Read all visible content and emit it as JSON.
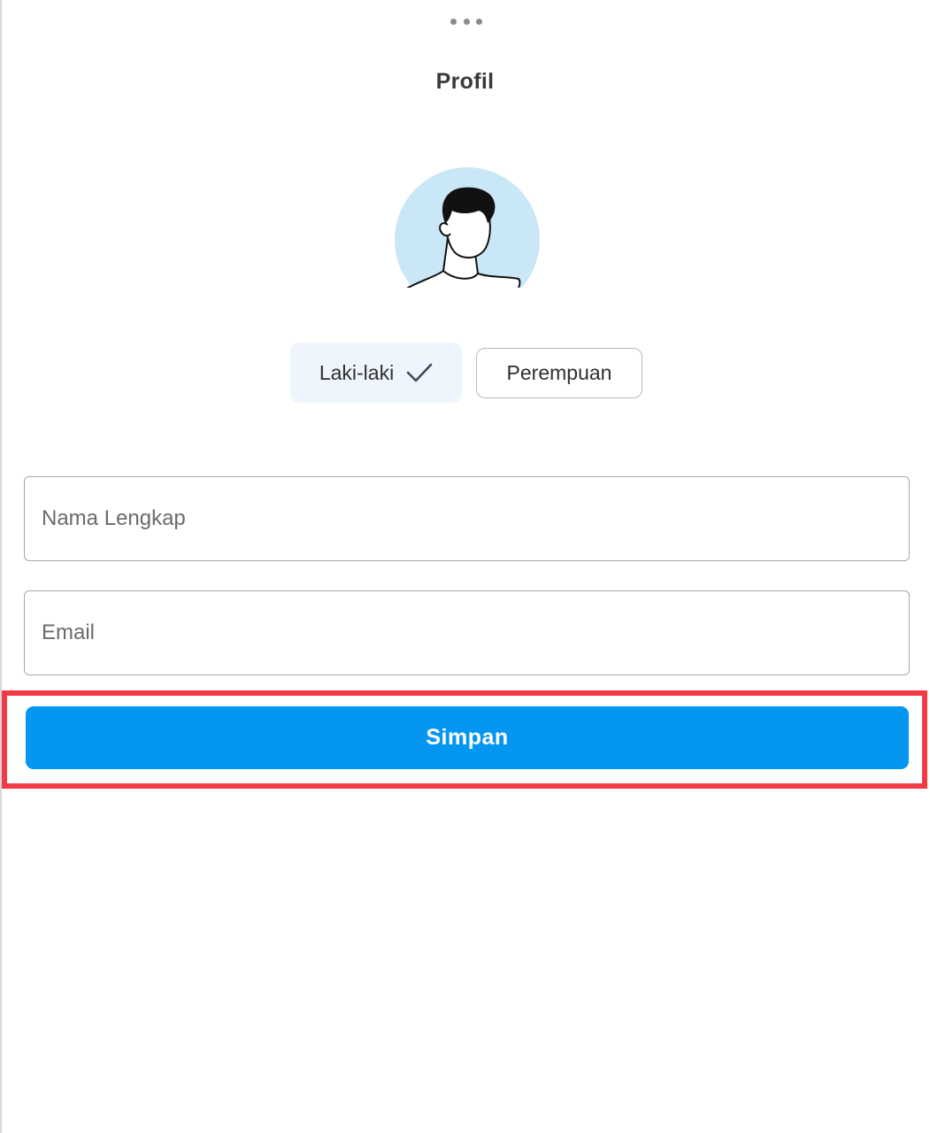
{
  "header": {
    "menu_icon": "more-horizontal-icon",
    "title": "Profil"
  },
  "avatar": {
    "icon": "male-avatar-icon",
    "background_color": "#c9e7f6"
  },
  "gender": {
    "options": [
      {
        "label": "Laki-laki",
        "selected": true,
        "icon": "check-icon"
      },
      {
        "label": "Perempuan",
        "selected": false
      }
    ]
  },
  "form": {
    "full_name": {
      "placeholder": "Nama Lengkap",
      "value": ""
    },
    "email": {
      "placeholder": "Email",
      "value": ""
    },
    "save_label": "Simpan"
  },
  "colors": {
    "primary_button": "#0596f2",
    "highlight_border": "#f23a46",
    "selected_option_bg": "#eef5fc"
  }
}
